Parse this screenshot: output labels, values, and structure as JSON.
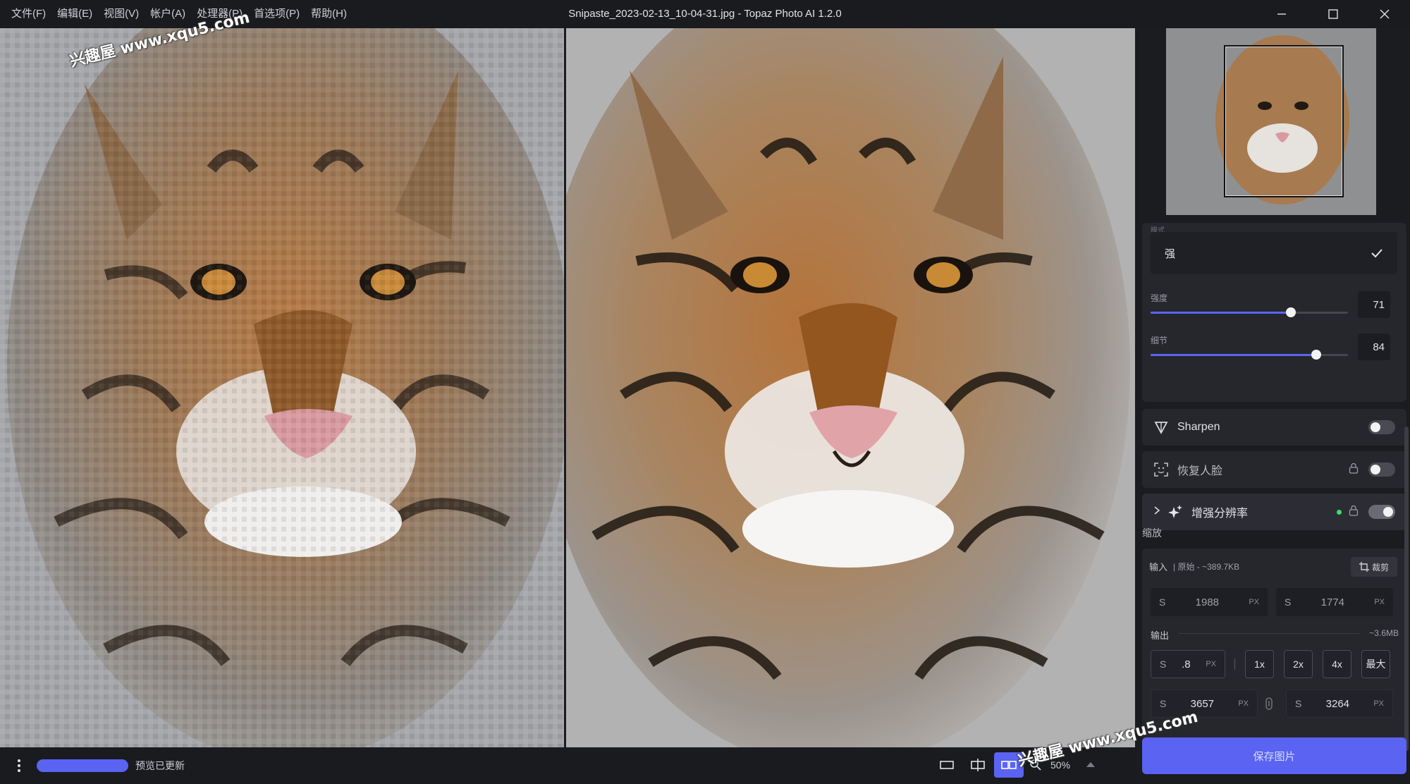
{
  "app": {
    "title": "Snipaste_2023-02-13_10-04-31.jpg - Topaz Photo AI 1.2.0",
    "menu": [
      "文件(F)",
      "编辑(E)",
      "视图(V)",
      "帐户(A)",
      "处理器(P)",
      "首选项(P)",
      "帮助(H)"
    ]
  },
  "watermark": "兴趣屋 www.xqu5.com",
  "panel": {
    "mode_partial_label": "模式",
    "mode_value": "强",
    "strength": {
      "label": "强度",
      "value": "71",
      "fraction": 0.71
    },
    "detail": {
      "label": "细节",
      "value": "84",
      "fraction": 0.84
    },
    "sharpen": {
      "label": "Sharpen",
      "enabled": false
    },
    "face_recovery": {
      "label": "恢复人脸",
      "enabled": false,
      "locked": true
    },
    "upscale": {
      "label": "增强分辨率",
      "enabled": true,
      "locked": true,
      "status_color": "#3ddc6b"
    },
    "scale_section": "缩放",
    "input": {
      "label": "输入",
      "meta": "| 原始 - ~389.7KB",
      "crop_label": "裁剪",
      "width": {
        "prefix": "S",
        "value": "1988",
        "unit": "PX"
      },
      "height": {
        "prefix": "S",
        "value": "1774",
        "unit": "PX"
      }
    },
    "output": {
      "label": "输出",
      "size": "~3.6MB",
      "scale": {
        "prefix": "S",
        "value": ".8",
        "unit": "PX"
      },
      "multipliers": [
        "1x",
        "2x",
        "4x",
        "最大"
      ],
      "width": {
        "prefix": "S",
        "value": "3657",
        "unit": "PX"
      },
      "height": {
        "prefix": "S",
        "value": "3264",
        "unit": "PX"
      }
    },
    "save_label": "保存图片"
  },
  "bottom": {
    "status": "预览已更新",
    "zoom": "50%"
  },
  "colors": {
    "accent": "#5a63f2",
    "panel": "#26272d",
    "background": "#1b1c20"
  }
}
